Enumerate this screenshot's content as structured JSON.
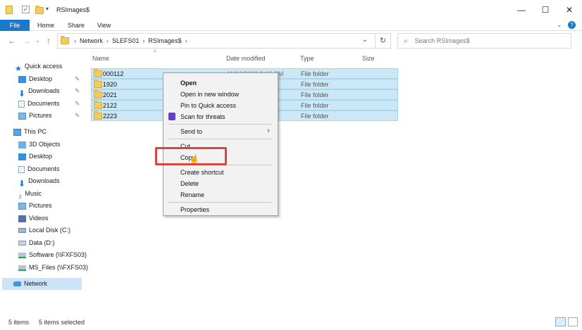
{
  "window": {
    "title": "RSImages$",
    "minimize": "—",
    "maximize": "☐",
    "close": "✕"
  },
  "ribbon": {
    "tabs": [
      "File",
      "Home",
      "Share",
      "View"
    ]
  },
  "address": {
    "parts": [
      "Network",
      "SLEFS01",
      "RSImages$"
    ],
    "dropdown": "⌄",
    "refresh": "↻"
  },
  "search": {
    "placeholder": "Search RSImages$"
  },
  "nav": {
    "quick_access": "Quick access",
    "quick_items": [
      "Desktop",
      "Downloads",
      "Documents",
      "Pictures"
    ],
    "this_pc": "This PC",
    "pc_items": [
      "3D Objects",
      "Desktop",
      "Documents",
      "Downloads",
      "Music",
      "Pictures",
      "Videos",
      "Local Disk (C:)",
      "Data (D:)",
      "Software (\\\\FXFS03)",
      "MS_Files (\\\\FXFS03)"
    ],
    "network": "Network"
  },
  "columns": {
    "name": "Name",
    "date": "Date modified",
    "type": "Type",
    "size": "Size"
  },
  "files": [
    {
      "name": "000112",
      "date": "11/10/2020 2:06 PM",
      "type": "File folder"
    },
    {
      "name": "1920",
      "date": "",
      "type": "File folder"
    },
    {
      "name": "2021",
      "date": "",
      "type": "File folder"
    },
    {
      "name": "2122",
      "date": "",
      "type": "File folder"
    },
    {
      "name": "2223",
      "date": "",
      "type": "File folder"
    }
  ],
  "context_menu": {
    "open": "Open",
    "open_new_window": "Open in new window",
    "pin_quick_access": "Pin to Quick access",
    "scan": "Scan for threats",
    "send_to": "Send to",
    "cut": "Cut",
    "copy": "Copy",
    "create_shortcut": "Create shortcut",
    "delete": "Delete",
    "rename": "Rename",
    "properties": "Properties"
  },
  "status": {
    "items": "5 items",
    "selected": "5 items selected"
  },
  "colors": {
    "accent": "#1979ca",
    "selection": "#cce8f6",
    "highlight_box": "#d9473c"
  }
}
